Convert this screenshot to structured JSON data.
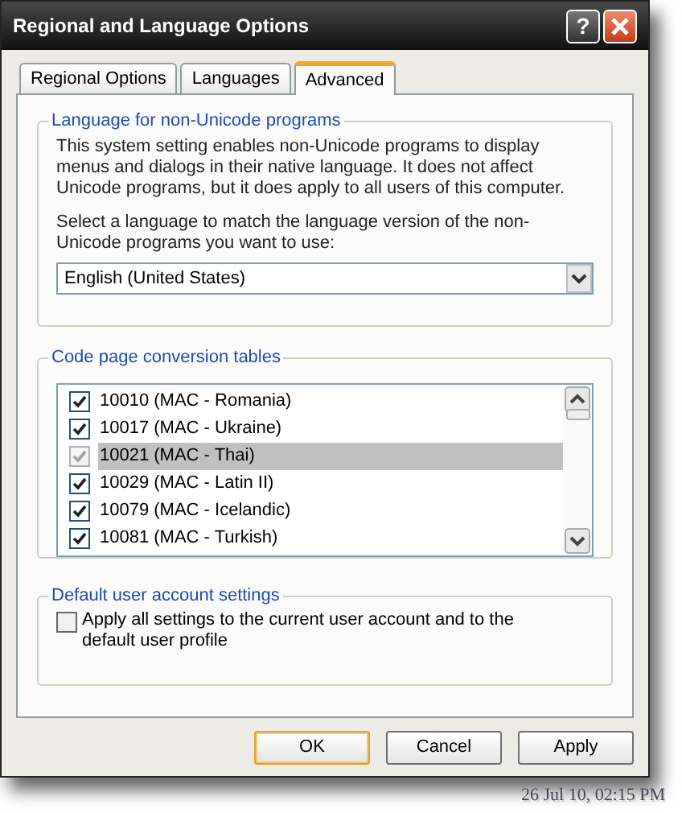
{
  "window": {
    "title": "Regional and Language Options",
    "title_buttons": [
      {
        "kind": "help",
        "label": "?"
      },
      {
        "kind": "close"
      }
    ]
  },
  "tabs": [
    {
      "label": "Regional Options",
      "selected": false
    },
    {
      "label": "Languages",
      "selected": false
    },
    {
      "label": "Advanced",
      "selected": true
    }
  ],
  "non_unicode_group": {
    "legend": "Language for non-Unicode programs",
    "description": "This system setting enables non-Unicode programs to display menus and dialogs in their native language. It does not affect Unicode programs, but it does apply to all users of this computer.",
    "prompt": "Select a language to match the language version of the non-Unicode programs you want to use:",
    "dropdown": {
      "value": "English (United States)"
    }
  },
  "code_page_group": {
    "legend": "Code page conversion tables",
    "items": [
      {
        "label": "10010 (MAC - Romania)",
        "checked": true,
        "disabled": false,
        "selected": false
      },
      {
        "label": "10017 (MAC - Ukraine)",
        "checked": true,
        "disabled": false,
        "selected": false
      },
      {
        "label": "10021 (MAC - Thai)",
        "checked": true,
        "disabled": true,
        "selected": true
      },
      {
        "label": "10029 (MAC - Latin II)",
        "checked": true,
        "disabled": false,
        "selected": false
      },
      {
        "label": "10079 (MAC - Icelandic)",
        "checked": true,
        "disabled": false,
        "selected": false
      },
      {
        "label": "10081 (MAC - Turkish)",
        "checked": true,
        "disabled": false,
        "selected": false
      }
    ]
  },
  "default_user_group": {
    "legend": "Default user account settings",
    "checkbox": {
      "label": "Apply all settings to the current user account and to the default user profile",
      "checked": false
    }
  },
  "buttons": [
    {
      "label": "OK",
      "default": true
    },
    {
      "label": "Cancel",
      "default": false
    },
    {
      "label": "Apply",
      "default": false
    }
  ],
  "timestamp": "26 Jul 10, 02:15 PM"
}
